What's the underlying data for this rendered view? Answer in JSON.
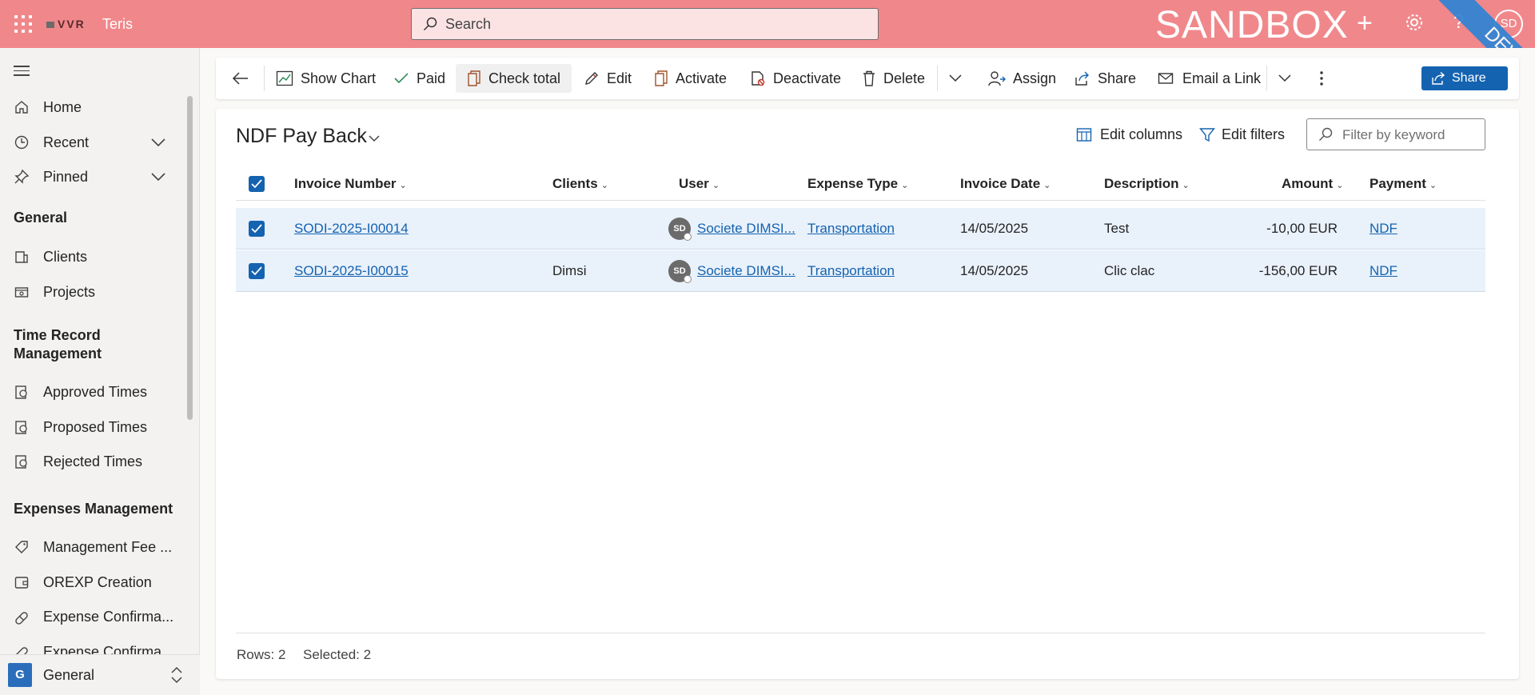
{
  "topbar": {
    "logo_text": "VVR",
    "app_name": "Teris",
    "search_placeholder": "Search",
    "environment_label": "SANDBOX",
    "dev_ribbon": "DEV",
    "user_initials": "SD",
    "help_glyph": "?",
    "plus_glyph": "+",
    "bg_color": "#f0888b"
  },
  "sidebar": {
    "top_items": [
      {
        "label": "Home",
        "icon": "home-icon"
      },
      {
        "label": "Recent",
        "icon": "clock-icon"
      },
      {
        "label": "Pinned",
        "icon": "pin-icon"
      }
    ],
    "sections": [
      {
        "title": "General",
        "items": [
          {
            "label": "Clients",
            "icon": "clients-icon"
          },
          {
            "label": "Projects",
            "icon": "projects-icon"
          }
        ]
      },
      {
        "title": "Time Record Management",
        "title_line1": "Time Record",
        "title_line2": "Management",
        "items": [
          {
            "label": "Approved Times",
            "icon": "time-icon"
          },
          {
            "label": "Proposed Times",
            "icon": "time-icon"
          },
          {
            "label": "Rejected Times",
            "icon": "time-icon"
          }
        ]
      },
      {
        "title": "Expenses Management",
        "items": [
          {
            "label": "Management Fee ...",
            "icon": "tag-icon"
          },
          {
            "label": "OREXP Creation",
            "icon": "wallet-icon"
          },
          {
            "label": "Expense Confirma...",
            "icon": "pill-icon"
          },
          {
            "label": "Expense Confirma...",
            "icon": "pill-icon"
          }
        ]
      }
    ],
    "area": {
      "letter": "G",
      "label": "General"
    }
  },
  "commands": {
    "show_chart": "Show Chart",
    "paid": "Paid",
    "check_total": "Check total",
    "edit": "Edit",
    "activate": "Activate",
    "deactivate": "Deactivate",
    "delete": "Delete",
    "assign": "Assign",
    "share": "Share",
    "email_link": "Email a Link",
    "share_button": "Share"
  },
  "view": {
    "title": "NDF Pay Back",
    "edit_columns": "Edit columns",
    "edit_filters": "Edit filters",
    "filter_placeholder": "Filter by keyword"
  },
  "grid": {
    "columns": [
      "Invoice Number",
      "Clients",
      "User",
      "Expense Type",
      "Invoice Date",
      "Description",
      "Amount",
      "Payment"
    ],
    "rows": [
      {
        "invoice": "SODI-2025-I00014",
        "client": "",
        "user_initials": "SD",
        "user": "Societe DIMSI...",
        "expense_type": "Transportation",
        "date": "14/05/2025",
        "description": "Test",
        "amount": "-10,00 EUR",
        "payment": "NDF"
      },
      {
        "invoice": "SODI-2025-I00015",
        "client": "Dimsi",
        "user_initials": "SD",
        "user": "Societe DIMSI...",
        "expense_type": "Transportation",
        "date": "14/05/2025",
        "description": "Clic clac",
        "amount": "-156,00 EUR",
        "payment": "NDF"
      }
    ],
    "footer": {
      "rows": "Rows: 2",
      "selected": "Selected: 2"
    }
  }
}
